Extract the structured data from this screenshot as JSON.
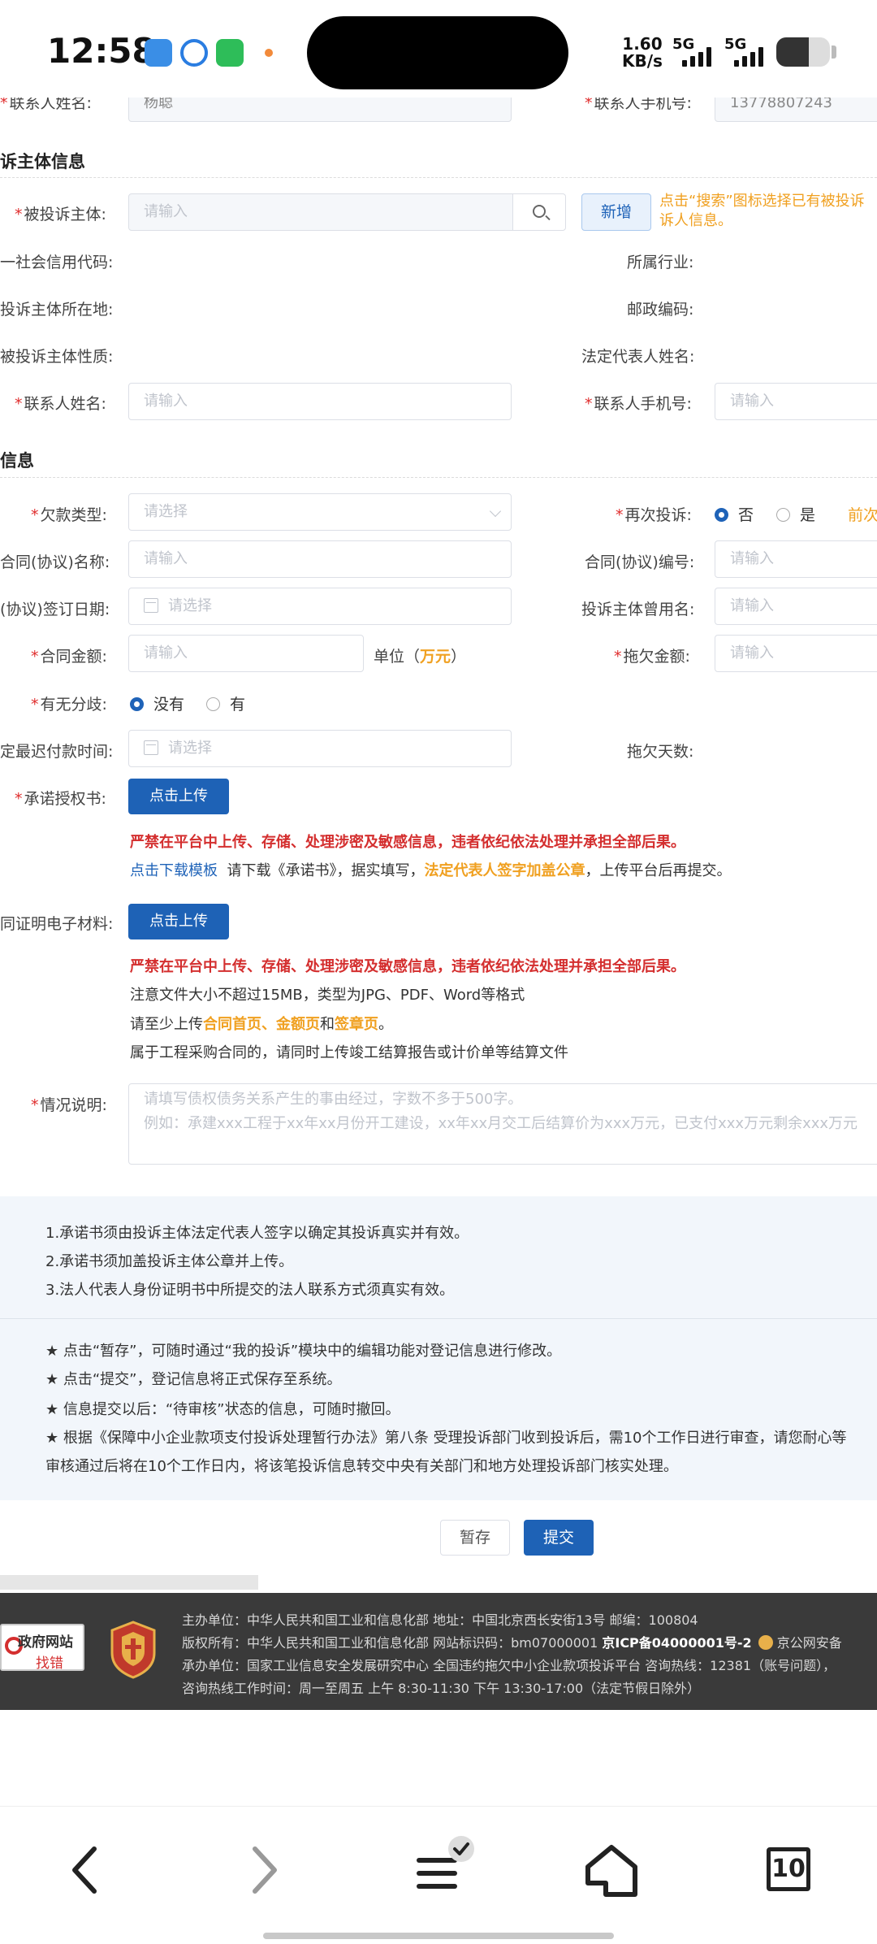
{
  "status_bar": {
    "time": "12:58",
    "speed_value": "1.60",
    "speed_unit": "KB/s",
    "net1": "5G",
    "net2": "5G",
    "battery_level": 0.6
  },
  "contact_top": {
    "name_label": "联系人姓名:",
    "name_value": "杨聪",
    "phone_label": "联系人手机号:",
    "phone_value": "13778807243"
  },
  "complained_section": {
    "title": "诉主体信息",
    "subject_label": "被投诉主体:",
    "subject_placeholder": "请输入",
    "new_button": "新增",
    "hint_line1": "点击“搜索”图标选择已有被投诉",
    "hint_line2": "诉人信息。",
    "credit_code_label": "一社会信用代码:",
    "industry_label": "所属行业:",
    "location_label": "投诉主体所在地:",
    "postal_label": "邮政编码:",
    "nature_label": "被投诉主体性质:",
    "legal_rep_label": "法定代表人姓名:",
    "contact_name_label": "联系人姓名:",
    "contact_name_placeholder": "请输入",
    "contact_phone_label": "联系人手机号:",
    "contact_phone_placeholder": "请输入"
  },
  "arrears_section": {
    "title": "信息",
    "type_label": "欠款类型:",
    "type_placeholder": "请选择",
    "re_complaint_label": "再次投诉:",
    "option_no": "否",
    "option_yes": "是",
    "re_complaint_hint": "前次",
    "contract_name_label": "合同(协议)名称:",
    "contract_name_placeholder": "请输入",
    "contract_no_label": "合同(协议)编号:",
    "contract_no_placeholder": "请输入",
    "sign_date_label": "(协议)签订日期:",
    "sign_date_placeholder": "请选择",
    "used_name_label": "投诉主体曾用名:",
    "used_name_placeholder": "请输入",
    "amount_label": "合同金额:",
    "amount_placeholder": "请输入",
    "unit_prefix": "单位（",
    "unit_value": "万元",
    "unit_suffix": "）",
    "owed_label": "拖欠金额:",
    "owed_placeholder": "请输入",
    "dispute_label": "有无分歧:",
    "dispute_no": "没有",
    "dispute_yes": "有",
    "deadline_label": "定最迟付款时间:",
    "deadline_placeholder": "请选择",
    "overdue_days_label": "拖欠天数:",
    "commitment_label": "承诺授权书:",
    "upload_button": "点击上传",
    "warning": "严禁在平台中上传、存储、处理涉密及敏感信息，违者依纪依法处理并承担全部后果。",
    "template_link": "点击下载模板",
    "template_text_a": "请下载《承诺书》，据实填写，",
    "template_text_b": "法定代表人签字加盖公章",
    "template_text_c": "，上传平台后再提交。",
    "evidence_label": "同证明电子材料:",
    "upload_button2": "点击上传",
    "warning2": "严禁在平台中上传、存储、处理涉密及敏感信息，违者依纪依法处理并承担全部后果。",
    "file_note": "注意文件大小不超过15MB，类型为JPG、PDF、Word等格式",
    "upload_note_a": "请至少上传",
    "upload_note_b": "合同首页、金额页",
    "upload_note_c": "和",
    "upload_note_d": "签章页",
    "upload_note_e": "。",
    "engineering_note": "属于工程采购合同的，请同时上传竣工结算报告或计价单等结算文件",
    "description_label": "情况说明:",
    "description_placeholder1": "请填写债权债务关系产生的事由经过，字数不多于500字。",
    "description_placeholder2": "例如：承建xxx工程于xx年xx月份开工建设，xx年xx月交工后结算价为xxx万元，已支付xxx万元剩余xxx万元"
  },
  "notices": {
    "rules": [
      "1.承诺书须由投诉主体法定代表人签字以确定其投诉真实并有效。",
      "2.承诺书须加盖投诉主体公章并上传。",
      "3.法人代表人身份证明书中所提交的法人联系方式须真实有效。"
    ],
    "tips": [
      "★ 点击“暂存”，可随时通过“我的投诉”模块中的编辑功能对登记信息进行修改。",
      "★ 点击“提交”，登记信息将正式保存至系统。",
      "★ 信息提交以后：“待审核”状态的信息，可随时撤回。",
      "★ 根据《保障中小企业款项支付投诉处理暂行办法》第八条 受理投诉部门收到投诉后，需10个工作日进行审查，请您耐心等",
      "审核通过后将在10个工作日内，将该笔投诉信息转交中央有关部门和地方处理投诉部门核实处理。"
    ]
  },
  "actions": {
    "save": "暂存",
    "submit": "提交"
  },
  "footer": {
    "badge_text1": "政府网站",
    "badge_text2": "找错",
    "line1": "主办单位：中华人民共和国工业和信息化部    地址：中国北京西长安街13号    邮编：100804",
    "line2_a": "版权所有：中华人民共和国工业和信息化部    网站标识码：bm07000001    ",
    "line2_b": "京ICP备04000001号-2",
    "line2_c": "  京公网安备",
    "line3": "承办单位：国家工业信息安全发展研究中心    全国违约拖欠中小企业款项投诉平台    咨询热线：12381（账号问题），",
    "line4": "咨询热线工作时间：周一至周五 上午 8:30-11:30 下午 13:30-17:00（法定节假日除外）"
  },
  "navbar": {
    "tabs_count": "10"
  },
  "colors": {
    "primary": "#1e62b6",
    "accent_orange": "#f0a020",
    "warning_red": "#d42f2f",
    "required_red": "#e02d2d",
    "footer_bg": "#3a3a3a"
  }
}
